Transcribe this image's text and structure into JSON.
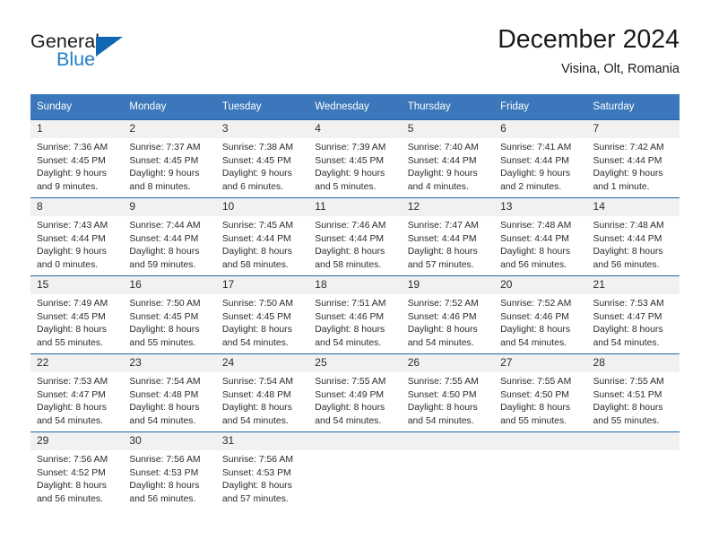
{
  "brand": {
    "name_part1": "General",
    "name_part2": "Blue",
    "triangle_color": "#1167b1",
    "blue_text_color": "#1d7cc4"
  },
  "header": {
    "title": "December 2024",
    "location": "Visina, Olt, Romania"
  },
  "theme": {
    "header_row_background": "#3b77ba",
    "header_row_text": "#ffffff",
    "row_separator": "#1f66ad",
    "daynumber_band": "#f1f1f1",
    "body_text": "#2b2b2b"
  },
  "weekday_headers": [
    "Sunday",
    "Monday",
    "Tuesday",
    "Wednesday",
    "Thursday",
    "Friday",
    "Saturday"
  ],
  "weeks": [
    [
      {
        "day": "1",
        "sunrise": "Sunrise: 7:36 AM",
        "sunset": "Sunset: 4:45 PM",
        "daylight1": "Daylight: 9 hours",
        "daylight2": "and 9 minutes."
      },
      {
        "day": "2",
        "sunrise": "Sunrise: 7:37 AM",
        "sunset": "Sunset: 4:45 PM",
        "daylight1": "Daylight: 9 hours",
        "daylight2": "and 8 minutes."
      },
      {
        "day": "3",
        "sunrise": "Sunrise: 7:38 AM",
        "sunset": "Sunset: 4:45 PM",
        "daylight1": "Daylight: 9 hours",
        "daylight2": "and 6 minutes."
      },
      {
        "day": "4",
        "sunrise": "Sunrise: 7:39 AM",
        "sunset": "Sunset: 4:45 PM",
        "daylight1": "Daylight: 9 hours",
        "daylight2": "and 5 minutes."
      },
      {
        "day": "5",
        "sunrise": "Sunrise: 7:40 AM",
        "sunset": "Sunset: 4:44 PM",
        "daylight1": "Daylight: 9 hours",
        "daylight2": "and 4 minutes."
      },
      {
        "day": "6",
        "sunrise": "Sunrise: 7:41 AM",
        "sunset": "Sunset: 4:44 PM",
        "daylight1": "Daylight: 9 hours",
        "daylight2": "and 2 minutes."
      },
      {
        "day": "7",
        "sunrise": "Sunrise: 7:42 AM",
        "sunset": "Sunset: 4:44 PM",
        "daylight1": "Daylight: 9 hours",
        "daylight2": "and 1 minute."
      }
    ],
    [
      {
        "day": "8",
        "sunrise": "Sunrise: 7:43 AM",
        "sunset": "Sunset: 4:44 PM",
        "daylight1": "Daylight: 9 hours",
        "daylight2": "and 0 minutes."
      },
      {
        "day": "9",
        "sunrise": "Sunrise: 7:44 AM",
        "sunset": "Sunset: 4:44 PM",
        "daylight1": "Daylight: 8 hours",
        "daylight2": "and 59 minutes."
      },
      {
        "day": "10",
        "sunrise": "Sunrise: 7:45 AM",
        "sunset": "Sunset: 4:44 PM",
        "daylight1": "Daylight: 8 hours",
        "daylight2": "and 58 minutes."
      },
      {
        "day": "11",
        "sunrise": "Sunrise: 7:46 AM",
        "sunset": "Sunset: 4:44 PM",
        "daylight1": "Daylight: 8 hours",
        "daylight2": "and 58 minutes."
      },
      {
        "day": "12",
        "sunrise": "Sunrise: 7:47 AM",
        "sunset": "Sunset: 4:44 PM",
        "daylight1": "Daylight: 8 hours",
        "daylight2": "and 57 minutes."
      },
      {
        "day": "13",
        "sunrise": "Sunrise: 7:48 AM",
        "sunset": "Sunset: 4:44 PM",
        "daylight1": "Daylight: 8 hours",
        "daylight2": "and 56 minutes."
      },
      {
        "day": "14",
        "sunrise": "Sunrise: 7:48 AM",
        "sunset": "Sunset: 4:44 PM",
        "daylight1": "Daylight: 8 hours",
        "daylight2": "and 56 minutes."
      }
    ],
    [
      {
        "day": "15",
        "sunrise": "Sunrise: 7:49 AM",
        "sunset": "Sunset: 4:45 PM",
        "daylight1": "Daylight: 8 hours",
        "daylight2": "and 55 minutes."
      },
      {
        "day": "16",
        "sunrise": "Sunrise: 7:50 AM",
        "sunset": "Sunset: 4:45 PM",
        "daylight1": "Daylight: 8 hours",
        "daylight2": "and 55 minutes."
      },
      {
        "day": "17",
        "sunrise": "Sunrise: 7:50 AM",
        "sunset": "Sunset: 4:45 PM",
        "daylight1": "Daylight: 8 hours",
        "daylight2": "and 54 minutes."
      },
      {
        "day": "18",
        "sunrise": "Sunrise: 7:51 AM",
        "sunset": "Sunset: 4:46 PM",
        "daylight1": "Daylight: 8 hours",
        "daylight2": "and 54 minutes."
      },
      {
        "day": "19",
        "sunrise": "Sunrise: 7:52 AM",
        "sunset": "Sunset: 4:46 PM",
        "daylight1": "Daylight: 8 hours",
        "daylight2": "and 54 minutes."
      },
      {
        "day": "20",
        "sunrise": "Sunrise: 7:52 AM",
        "sunset": "Sunset: 4:46 PM",
        "daylight1": "Daylight: 8 hours",
        "daylight2": "and 54 minutes."
      },
      {
        "day": "21",
        "sunrise": "Sunrise: 7:53 AM",
        "sunset": "Sunset: 4:47 PM",
        "daylight1": "Daylight: 8 hours",
        "daylight2": "and 54 minutes."
      }
    ],
    [
      {
        "day": "22",
        "sunrise": "Sunrise: 7:53 AM",
        "sunset": "Sunset: 4:47 PM",
        "daylight1": "Daylight: 8 hours",
        "daylight2": "and 54 minutes."
      },
      {
        "day": "23",
        "sunrise": "Sunrise: 7:54 AM",
        "sunset": "Sunset: 4:48 PM",
        "daylight1": "Daylight: 8 hours",
        "daylight2": "and 54 minutes."
      },
      {
        "day": "24",
        "sunrise": "Sunrise: 7:54 AM",
        "sunset": "Sunset: 4:48 PM",
        "daylight1": "Daylight: 8 hours",
        "daylight2": "and 54 minutes."
      },
      {
        "day": "25",
        "sunrise": "Sunrise: 7:55 AM",
        "sunset": "Sunset: 4:49 PM",
        "daylight1": "Daylight: 8 hours",
        "daylight2": "and 54 minutes."
      },
      {
        "day": "26",
        "sunrise": "Sunrise: 7:55 AM",
        "sunset": "Sunset: 4:50 PM",
        "daylight1": "Daylight: 8 hours",
        "daylight2": "and 54 minutes."
      },
      {
        "day": "27",
        "sunrise": "Sunrise: 7:55 AM",
        "sunset": "Sunset: 4:50 PM",
        "daylight1": "Daylight: 8 hours",
        "daylight2": "and 55 minutes."
      },
      {
        "day": "28",
        "sunrise": "Sunrise: 7:55 AM",
        "sunset": "Sunset: 4:51 PM",
        "daylight1": "Daylight: 8 hours",
        "daylight2": "and 55 minutes."
      }
    ],
    [
      {
        "day": "29",
        "sunrise": "Sunrise: 7:56 AM",
        "sunset": "Sunset: 4:52 PM",
        "daylight1": "Daylight: 8 hours",
        "daylight2": "and 56 minutes."
      },
      {
        "day": "30",
        "sunrise": "Sunrise: 7:56 AM",
        "sunset": "Sunset: 4:53 PM",
        "daylight1": "Daylight: 8 hours",
        "daylight2": "and 56 minutes."
      },
      {
        "day": "31",
        "sunrise": "Sunrise: 7:56 AM",
        "sunset": "Sunset: 4:53 PM",
        "daylight1": "Daylight: 8 hours",
        "daylight2": "and 57 minutes."
      },
      {
        "day": "",
        "sunrise": "",
        "sunset": "",
        "daylight1": "",
        "daylight2": ""
      },
      {
        "day": "",
        "sunrise": "",
        "sunset": "",
        "daylight1": "",
        "daylight2": ""
      },
      {
        "day": "",
        "sunrise": "",
        "sunset": "",
        "daylight1": "",
        "daylight2": ""
      },
      {
        "day": "",
        "sunrise": "",
        "sunset": "",
        "daylight1": "",
        "daylight2": ""
      }
    ]
  ]
}
